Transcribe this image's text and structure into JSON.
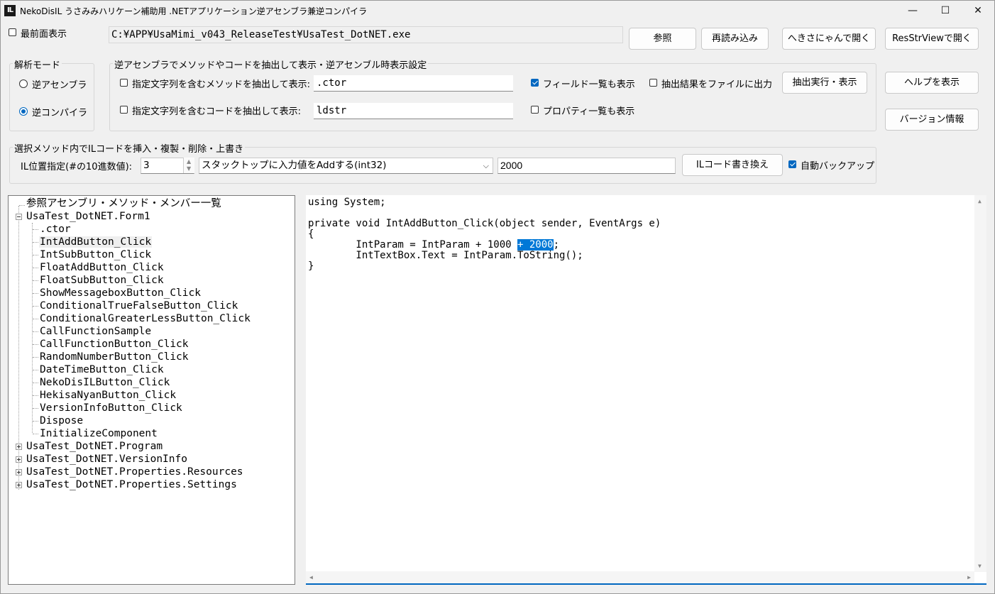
{
  "window": {
    "icon_text": "IL",
    "title": "NekoDisIL うさみみハリケーン補助用 .NETアプリケーション逆アセンブラ兼逆コンパイラ",
    "minimize": "—",
    "maximize": "☐",
    "close": "✕"
  },
  "top": {
    "topmost_label": "最前面表示",
    "topmost_checked": false,
    "path": "C:¥APP¥UsaMimi_v043_ReleaseTest¥UsaTest_DotNET.exe",
    "browse_label": "参照",
    "reload_label": "再読み込み",
    "hekisa_label": "へきさにゃんで開く",
    "resstr_label": "ResStrViewで開く"
  },
  "mode": {
    "title": "解析モード",
    "disasm_label": "逆アセンブラ",
    "decomp_label": "逆コンパイラ",
    "selected": "decomp"
  },
  "extract": {
    "title": "逆アセンブラでメソッドやコードを抽出して表示・逆アセンブル時表示設定",
    "method_filter_label": "指定文字列を含むメソッドを抽出して表示:",
    "method_filter_value": ".ctor",
    "code_filter_label": "指定文字列を含むコードを抽出して表示:",
    "code_filter_value": "ldstr",
    "show_fields_label": "フィールド一覧も表示",
    "show_props_label": "プロパティ一覧も表示",
    "output_file_label": "抽出結果をファイルに出力",
    "run_label": "抽出実行・表示"
  },
  "side": {
    "help_label": "ヘルプを表示",
    "version_label": "バージョン情報"
  },
  "il": {
    "title": "選択メソッド内でILコードを挿入・複製・削除・上書き",
    "pos_label": "IL位置指定(#の10進数値):",
    "pos_value": "3",
    "op_value": "スタックトップに入力値をAddする(int32)",
    "arg_value": "2000",
    "rewrite_label": "ILコード書き換え",
    "backup_label": "自動バックアップ"
  },
  "tree": {
    "root": "参照アセンブリ・メソッド・メンバー一覧",
    "form1": "UsaTest_DotNET.Form1",
    "methods": [
      ".ctor",
      "IntAddButton_Click",
      "IntSubButton_Click",
      "FloatAddButton_Click",
      "FloatSubButton_Click",
      "ShowMessageboxButton_Click",
      "ConditionalTrueFalseButton_Click",
      "ConditionalGreaterLessButton_Click",
      "CallFunctionSample",
      "CallFunctionButton_Click",
      "RandomNumberButton_Click",
      "DateTimeButton_Click",
      "NekoDisILButton_Click",
      "HekisaNyanButton_Click",
      "VersionInfoButton_Click",
      "Dispose",
      "InitializeComponent"
    ],
    "others": [
      "UsaTest_DotNET.Program",
      "UsaTest_DotNET.VersionInfo",
      "UsaTest_DotNET.Properties.Resources",
      "UsaTest_DotNET.Properties.Settings"
    ]
  },
  "code": {
    "line1": "using System;",
    "line3": "private void IntAddButton_Click(object sender, EventArgs e)",
    "line4": "{",
    "line5_pre": "        IntParam = IntParam + 1000 ",
    "line5_hl": "+ 2000",
    "line5_post": ";",
    "line6": "        IntTextBox.Text = IntParam.ToString();",
    "line7": "}"
  }
}
